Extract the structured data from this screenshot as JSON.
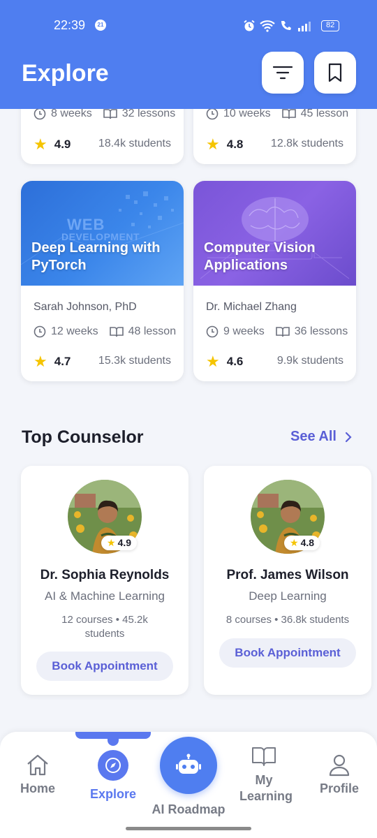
{
  "status_bar": {
    "time": "22:39",
    "badge": "21",
    "battery": "82"
  },
  "header": {
    "title": "Explore"
  },
  "courses_partial": [
    {
      "duration": "8 weeks",
      "lessons": "32 lessons",
      "rating": "4.9",
      "students": "18.4k students"
    },
    {
      "duration": "10 weeks",
      "lessons": "45 lesson",
      "rating": "4.8",
      "students": "12.8k students"
    }
  ],
  "courses": [
    {
      "title": "Deep Learning with PyTorch",
      "image_text_1": "WEB",
      "image_text_2": "DEVELOPMENT",
      "instructor": "Sarah Johnson, PhD",
      "duration": "12 weeks",
      "lessons": "48 lesson",
      "rating": "4.7",
      "students": "15.3k students"
    },
    {
      "title": "Computer Vision Applications",
      "instructor": "Dr. Michael Zhang",
      "duration": "9 weeks",
      "lessons": "36 lessons",
      "rating": "4.6",
      "students": "9.9k students"
    }
  ],
  "counselor_section": {
    "title": "Top Counselor",
    "see_all": "See All"
  },
  "counselors": [
    {
      "name": "Dr. Sophia Reynolds",
      "field": "AI & Machine Learning",
      "stats": "12 courses • 45.2k students",
      "rating": "4.9",
      "button": "Book Appointment"
    },
    {
      "name": "Prof. James Wilson",
      "field": "Deep Learning",
      "stats": "8 courses • 36.8k students",
      "rating": "4.8",
      "button": "Book Appointment"
    }
  ],
  "nav": {
    "home": "Home",
    "explore": "Explore",
    "ai": "AI Roadmap",
    "learning": "My Learning",
    "profile": "Profile"
  },
  "colors": {
    "primary": "#4f7ef0",
    "accent": "#5a5fd6",
    "star": "#f5c400"
  }
}
